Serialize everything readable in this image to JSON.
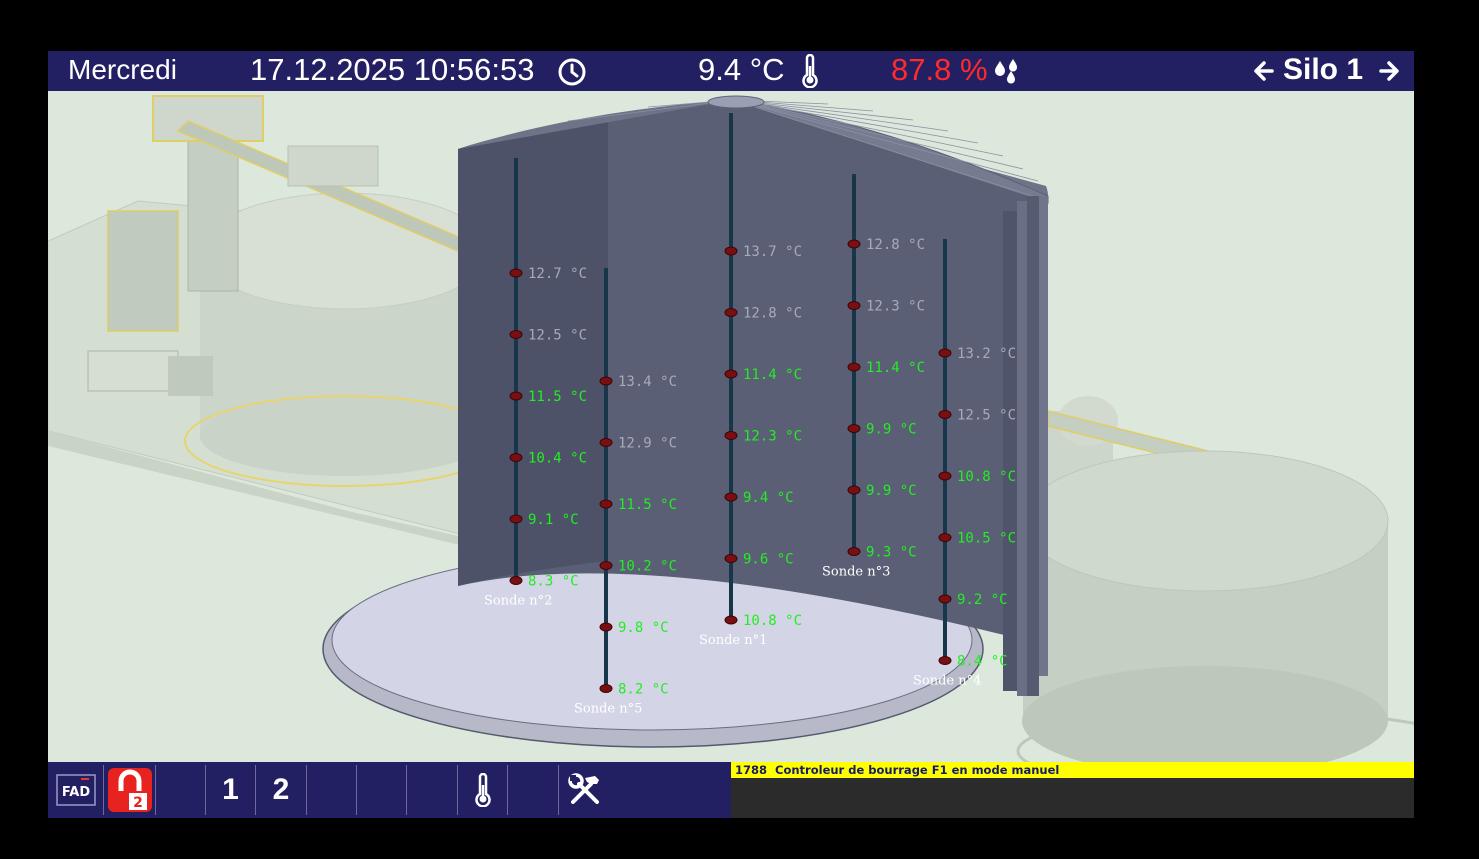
{
  "header": {
    "day": "Mercredi",
    "datetime": "17.12.2025 10:56:53",
    "temperature": "9.4 °C",
    "humidity": "87.8 %",
    "silo": "Silo 1",
    "icons": [
      "clock-icon",
      "thermometer-icon",
      "humidity-drops-icon",
      "arrow-left-icon",
      "arrow-right-icon"
    ]
  },
  "colors": {
    "header_bg": "#221f63",
    "humidity_text": "#ff2a2a",
    "reading_green": "#22ee22",
    "reading_grey": "#a8aab8",
    "alarm_bg": "#ffff00"
  },
  "probes": [
    {
      "id": "sonde2",
      "label": "Sonde n°2",
      "readings": [
        {
          "value": "12.7 °C",
          "state": "grey"
        },
        {
          "value": "12.5 °C",
          "state": "grey"
        },
        {
          "value": "11.5 °C",
          "state": "green"
        },
        {
          "value": "10.4 °C",
          "state": "green"
        },
        {
          "value": "9.1 °C",
          "state": "green"
        },
        {
          "value": "8.3 °C",
          "state": "green"
        }
      ]
    },
    {
      "id": "sonde5",
      "label": "Sonde n°5",
      "readings": [
        {
          "value": "13.4 °C",
          "state": "grey"
        },
        {
          "value": "12.9 °C",
          "state": "grey"
        },
        {
          "value": "11.5 °C",
          "state": "green"
        },
        {
          "value": "10.2 °C",
          "state": "green"
        },
        {
          "value": "9.8 °C",
          "state": "green"
        },
        {
          "value": "8.2 °C",
          "state": "green"
        }
      ]
    },
    {
      "id": "sonde1",
      "label": "Sonde n°1",
      "readings": [
        {
          "value": "13.7 °C",
          "state": "grey"
        },
        {
          "value": "12.8 °C",
          "state": "grey"
        },
        {
          "value": "11.4 °C",
          "state": "green"
        },
        {
          "value": "12.3 °C",
          "state": "green"
        },
        {
          "value": "9.4 °C",
          "state": "green"
        },
        {
          "value": "9.6 °C",
          "state": "green"
        },
        {
          "value": "10.8 °C",
          "state": "green"
        }
      ]
    },
    {
      "id": "sonde3",
      "label": "Sonde n°3",
      "readings": [
        {
          "value": "12.8 °C",
          "state": "grey"
        },
        {
          "value": "12.3 °C",
          "state": "grey"
        },
        {
          "value": "11.4 °C",
          "state": "green"
        },
        {
          "value": "9.9 °C",
          "state": "green"
        },
        {
          "value": "9.9 °C",
          "state": "green"
        },
        {
          "value": "9.3 °C",
          "state": "green"
        }
      ]
    },
    {
      "id": "sonde4",
      "label": "Sonde n°4",
      "readings": [
        {
          "value": "13.2 °C",
          "state": "grey"
        },
        {
          "value": "12.5 °C",
          "state": "grey"
        },
        {
          "value": "10.8 °C",
          "state": "green"
        },
        {
          "value": "10.5 °C",
          "state": "green"
        },
        {
          "value": "9.2 °C",
          "state": "green"
        },
        {
          "value": "8.4 °C",
          "state": "green"
        }
      ]
    }
  ],
  "toolbar": {
    "buttons": [
      {
        "name": "fad-button",
        "label": "FAD",
        "icon": "fad-icon"
      },
      {
        "name": "lock-2-button",
        "label": "2",
        "icon": "padlock-icon"
      },
      {
        "name": "empty-button-1",
        "label": ""
      },
      {
        "name": "button-1",
        "label": "1"
      },
      {
        "name": "button-2",
        "label": "2"
      },
      {
        "name": "empty-button-2",
        "label": ""
      },
      {
        "name": "empty-button-3",
        "label": ""
      },
      {
        "name": "empty-button-4",
        "label": ""
      },
      {
        "name": "thermometer-button",
        "label": "",
        "icon": "thermometer-icon"
      },
      {
        "name": "empty-button-5",
        "label": ""
      },
      {
        "name": "tools-button",
        "label": "",
        "icon": "hammer-wrench-icon"
      }
    ]
  },
  "alarm": {
    "code": "1788",
    "message": "Controleur de bourrage F1 en mode manuel"
  }
}
